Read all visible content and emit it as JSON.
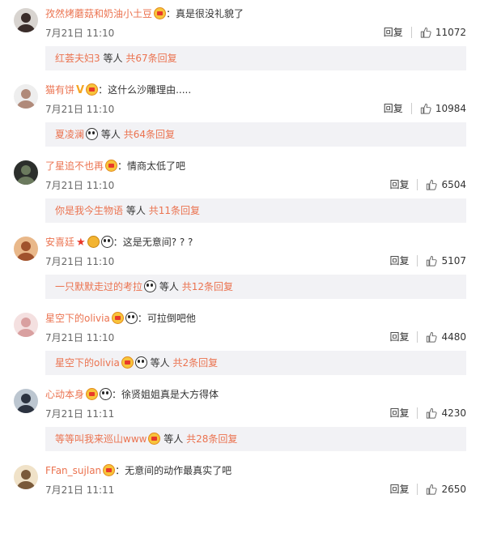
{
  "like_icon": "thumbs-up-icon",
  "reply_label": "回复",
  "etc_label": "等人",
  "comments": [
    {
      "user": "孜然烤蘑菇和奶油小土豆",
      "badges": [
        "gift"
      ],
      "sep": "：",
      "text": "真是很没礼貌了",
      "time": "7月21日 11:10",
      "likes": "11072",
      "replies": {
        "names": "红荟夫妇3",
        "badges": [],
        "total": "共67条回复"
      }
    },
    {
      "user": "猫有饼",
      "badges": [
        "v",
        "gift"
      ],
      "sep": "：",
      "text": "这什么沙雕理由.....",
      "time": "7月21日 11:10",
      "likes": "10984",
      "replies": {
        "names": "夏凌澜",
        "badges": [
          "panda"
        ],
        "total": "共64条回复"
      }
    },
    {
      "user": "了星追不也再",
      "badges": [
        "gift"
      ],
      "sep": "：",
      "text": "情商太低了吧",
      "time": "7月21日 11:10",
      "likes": "6504",
      "replies": {
        "names": "你是我今生物语",
        "badges": [],
        "total": "共11条回复"
      }
    },
    {
      "user": "安喜廷",
      "badges": [
        "star",
        "gold",
        "panda"
      ],
      "sep": "：",
      "text": "这是无意间? ? ?",
      "time": "7月21日 11:10",
      "likes": "5107",
      "replies": {
        "names": "一只默默走过的考拉",
        "badges": [
          "panda"
        ],
        "total": "共12条回复"
      }
    },
    {
      "user": "星空下的olivia",
      "badges": [
        "gift",
        "panda"
      ],
      "sep": "：",
      "text": "可拉倒吧他",
      "time": "7月21日 11:10",
      "likes": "4480",
      "replies": {
        "names": "星空下的olivia",
        "badges": [
          "gift",
          "panda"
        ],
        "total": "共2条回复"
      }
    },
    {
      "user": "心动本身",
      "badges": [
        "gift",
        "panda"
      ],
      "sep": "：",
      "text": "徐贤姐姐真是大方得体",
      "time": "7月21日 11:11",
      "likes": "4230",
      "replies": {
        "names": "等等叫我来巡山www",
        "badges": [
          "gift"
        ],
        "total": "共28条回复"
      }
    },
    {
      "user": "FFan_sujlan",
      "badges": [
        "gift"
      ],
      "sep": "：",
      "text": "无意间的动作最真实了吧",
      "time": "7月21日 11:11",
      "likes": "2650",
      "replies": null
    }
  ]
}
